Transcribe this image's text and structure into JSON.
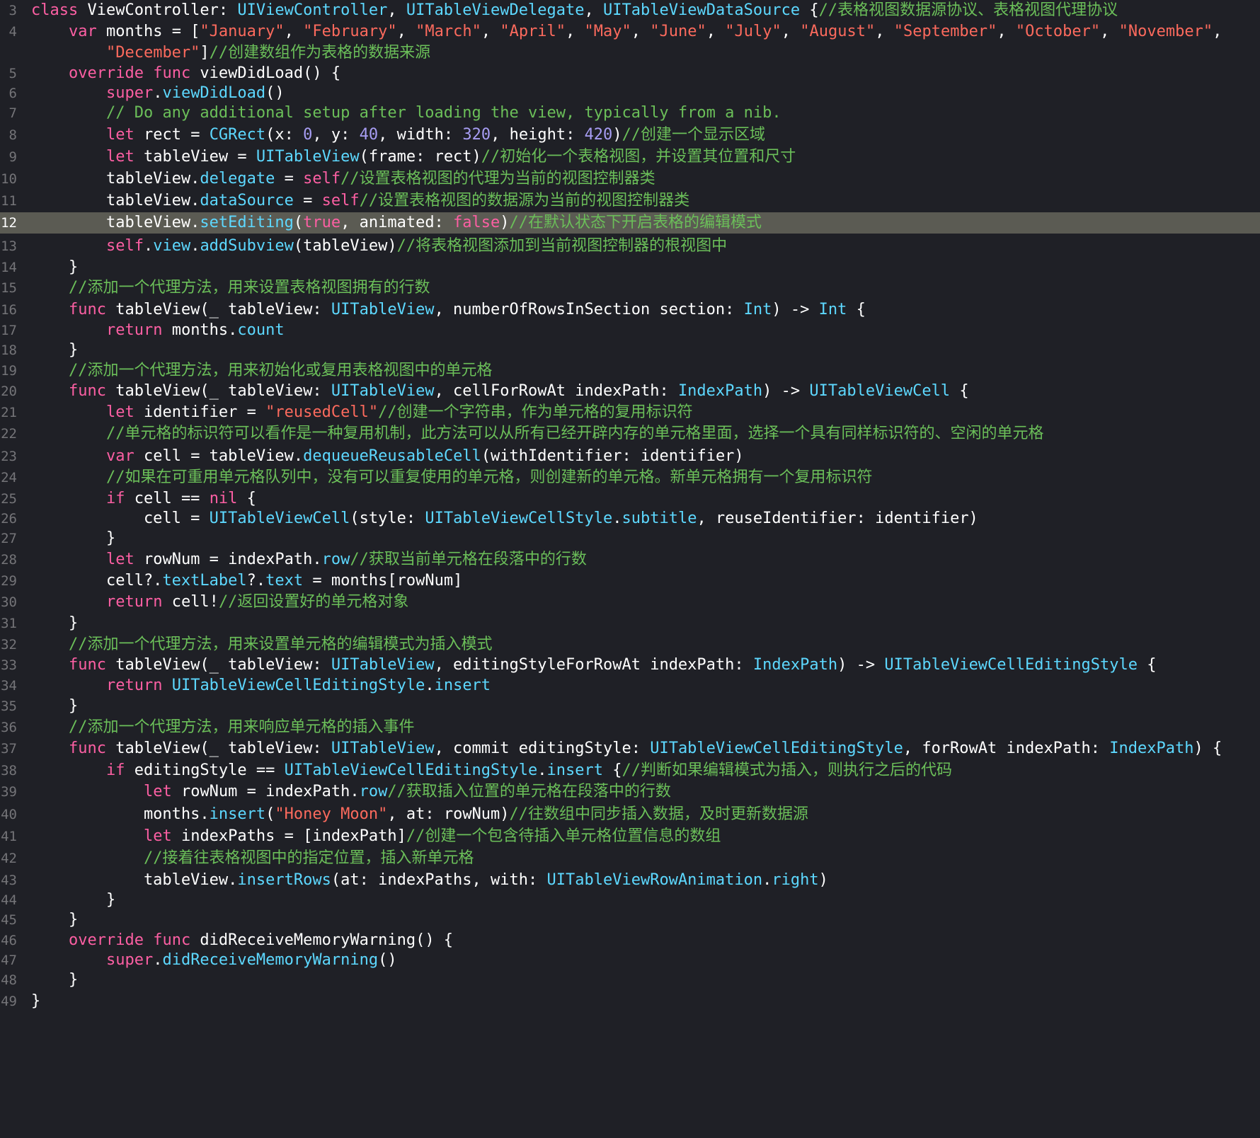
{
  "editor": {
    "language": "Swift",
    "theme": {
      "background": "#1f2026",
      "highlight_line": "#5b5b53",
      "gutter_text": "#747478",
      "keyword": "#fc5fa3",
      "type": "#5dd8ff",
      "string": "#fc6a5d",
      "comment": "#6bbf59",
      "number": "#a79df3",
      "plain": "#ffffff"
    },
    "highlighted_line": 12,
    "lines": [
      {
        "n": "3",
        "tokens": [
          [
            "kw",
            "class"
          ],
          [
            "pl",
            " ViewController: "
          ],
          [
            "ty",
            "UIViewController"
          ],
          [
            "pl",
            ", "
          ],
          [
            "ty",
            "UITableViewDelegate"
          ],
          [
            "pl",
            ", "
          ],
          [
            "ty",
            "UITableViewDataSource"
          ],
          [
            "pl",
            " {"
          ],
          [
            "cm",
            "//表格视图数据源协议、表格视图代理协议"
          ]
        ]
      },
      {
        "n": "4",
        "tokens": [
          [
            "pl",
            "    "
          ],
          [
            "kw",
            "var"
          ],
          [
            "pl",
            " months = ["
          ],
          [
            "st",
            "\"January\""
          ],
          [
            "pl",
            ", "
          ],
          [
            "st",
            "\"February\""
          ],
          [
            "pl",
            ", "
          ],
          [
            "st",
            "\"March\""
          ],
          [
            "pl",
            ", "
          ],
          [
            "st",
            "\"April\""
          ],
          [
            "pl",
            ", "
          ],
          [
            "st",
            "\"May\""
          ],
          [
            "pl",
            ", "
          ],
          [
            "st",
            "\"June\""
          ],
          [
            "pl",
            ", "
          ],
          [
            "st",
            "\"July\""
          ],
          [
            "pl",
            ", "
          ],
          [
            "st",
            "\"August\""
          ],
          [
            "pl",
            ", "
          ],
          [
            "st",
            "\"September\""
          ],
          [
            "pl",
            ", "
          ],
          [
            "st",
            "\"October\""
          ],
          [
            "pl",
            ", "
          ],
          [
            "st",
            "\"November\""
          ],
          [
            "pl",
            ","
          ]
        ]
      },
      {
        "n": "",
        "tokens": [
          [
            "pl",
            "        "
          ],
          [
            "st",
            "\"December\""
          ],
          [
            "pl",
            "]"
          ],
          [
            "cm",
            "//创建数组作为表格的数据来源"
          ]
        ]
      },
      {
        "n": "5",
        "tokens": [
          [
            "pl",
            "    "
          ],
          [
            "kw",
            "override"
          ],
          [
            "pl",
            " "
          ],
          [
            "kw",
            "func"
          ],
          [
            "pl",
            " viewDidLoad() {"
          ]
        ]
      },
      {
        "n": "6",
        "tokens": [
          [
            "pl",
            "        "
          ],
          [
            "kw",
            "super"
          ],
          [
            "pl",
            "."
          ],
          [
            "ty",
            "viewDidLoad"
          ],
          [
            "pl",
            "()"
          ]
        ]
      },
      {
        "n": "7",
        "tokens": [
          [
            "pl",
            "        "
          ],
          [
            "cm",
            "// Do any additional setup after loading the view, typically from a nib."
          ]
        ]
      },
      {
        "n": "8",
        "tokens": [
          [
            "pl",
            "        "
          ],
          [
            "kw",
            "let"
          ],
          [
            "pl",
            " rect = "
          ],
          [
            "ty",
            "CGRect"
          ],
          [
            "pl",
            "(x: "
          ],
          [
            "nu",
            "0"
          ],
          [
            "pl",
            ", y: "
          ],
          [
            "nu",
            "40"
          ],
          [
            "pl",
            ", width: "
          ],
          [
            "nu",
            "320"
          ],
          [
            "pl",
            ", height: "
          ],
          [
            "nu",
            "420"
          ],
          [
            "pl",
            ")"
          ],
          [
            "cm",
            "//创建一个显示区域"
          ]
        ]
      },
      {
        "n": "9",
        "tokens": [
          [
            "pl",
            "        "
          ],
          [
            "kw",
            "let"
          ],
          [
            "pl",
            " tableView = "
          ],
          [
            "ty",
            "UITableView"
          ],
          [
            "pl",
            "(frame: rect)"
          ],
          [
            "cm",
            "//初始化一个表格视图，并设置其位置和尺寸"
          ]
        ]
      },
      {
        "n": "10",
        "tokens": [
          [
            "pl",
            "        tableView."
          ],
          [
            "ty",
            "delegate"
          ],
          [
            "pl",
            " = "
          ],
          [
            "kw",
            "self"
          ],
          [
            "cm",
            "//设置表格视图的代理为当前的视图控制器类"
          ]
        ]
      },
      {
        "n": "11",
        "tokens": [
          [
            "pl",
            "        tableView."
          ],
          [
            "ty",
            "dataSource"
          ],
          [
            "pl",
            " = "
          ],
          [
            "kw",
            "self"
          ],
          [
            "cm",
            "//设置表格视图的数据源为当前的视图控制器类"
          ]
        ]
      },
      {
        "n": "12",
        "tokens": [
          [
            "pl",
            "        tableView."
          ],
          [
            "ty",
            "setEditing"
          ],
          [
            "pl",
            "("
          ],
          [
            "kw",
            "true"
          ],
          [
            "pl",
            ", animated: "
          ],
          [
            "kw",
            "false"
          ],
          [
            "pl",
            ")"
          ],
          [
            "cm",
            "//在默认状态下开启表格的编辑模式"
          ]
        ]
      },
      {
        "n": "13",
        "tokens": [
          [
            "pl",
            "        "
          ],
          [
            "kw",
            "self"
          ],
          [
            "pl",
            "."
          ],
          [
            "ty",
            "view"
          ],
          [
            "pl",
            "."
          ],
          [
            "ty",
            "addSubview"
          ],
          [
            "pl",
            "(tableView)"
          ],
          [
            "cm",
            "//将表格视图添加到当前视图控制器的根视图中"
          ]
        ]
      },
      {
        "n": "14",
        "tokens": [
          [
            "pl",
            "    }"
          ]
        ]
      },
      {
        "n": "15",
        "tokens": [
          [
            "pl",
            "    "
          ],
          [
            "cm",
            "//添加一个代理方法，用来设置表格视图拥有的行数"
          ]
        ]
      },
      {
        "n": "16",
        "tokens": [
          [
            "pl",
            "    "
          ],
          [
            "kw",
            "func"
          ],
          [
            "pl",
            " tableView(_ tableView: "
          ],
          [
            "ty",
            "UITableView"
          ],
          [
            "pl",
            ", numberOfRowsInSection section: "
          ],
          [
            "ty",
            "Int"
          ],
          [
            "pl",
            ") -> "
          ],
          [
            "ty",
            "Int"
          ],
          [
            "pl",
            " {"
          ]
        ]
      },
      {
        "n": "17",
        "tokens": [
          [
            "pl",
            "        "
          ],
          [
            "kw",
            "return"
          ],
          [
            "pl",
            " months."
          ],
          [
            "ty",
            "count"
          ]
        ]
      },
      {
        "n": "18",
        "tokens": [
          [
            "pl",
            "    }"
          ]
        ]
      },
      {
        "n": "19",
        "tokens": [
          [
            "pl",
            "    "
          ],
          [
            "cm",
            "//添加一个代理方法，用来初始化或复用表格视图中的单元格"
          ]
        ]
      },
      {
        "n": "20",
        "tokens": [
          [
            "pl",
            "    "
          ],
          [
            "kw",
            "func"
          ],
          [
            "pl",
            " tableView(_ tableView: "
          ],
          [
            "ty",
            "UITableView"
          ],
          [
            "pl",
            ", cellForRowAt indexPath: "
          ],
          [
            "ty",
            "IndexPath"
          ],
          [
            "pl",
            ") -> "
          ],
          [
            "ty",
            "UITableViewCell"
          ],
          [
            "pl",
            " {"
          ]
        ]
      },
      {
        "n": "21",
        "tokens": [
          [
            "pl",
            "        "
          ],
          [
            "kw",
            "let"
          ],
          [
            "pl",
            " identifier = "
          ],
          [
            "st",
            "\"reusedCell\""
          ],
          [
            "cm",
            "//创建一个字符串，作为单元格的复用标识符"
          ]
        ]
      },
      {
        "n": "22",
        "tokens": [
          [
            "pl",
            "        "
          ],
          [
            "cm",
            "//单元格的标识符可以看作是一种复用机制，此方法可以从所有已经开辟内存的单元格里面，选择一个具有同样标识符的、空闲的单元格"
          ]
        ]
      },
      {
        "n": "23",
        "tokens": [
          [
            "pl",
            "        "
          ],
          [
            "kw",
            "var"
          ],
          [
            "pl",
            " cell = tableView."
          ],
          [
            "ty",
            "dequeueReusableCell"
          ],
          [
            "pl",
            "(withIdentifier: identifier)"
          ]
        ]
      },
      {
        "n": "24",
        "tokens": [
          [
            "pl",
            "        "
          ],
          [
            "cm",
            "//如果在可重用单元格队列中，没有可以重复使用的单元格，则创建新的单元格。新单元格拥有一个复用标识符"
          ]
        ]
      },
      {
        "n": "25",
        "tokens": [
          [
            "pl",
            "        "
          ],
          [
            "kw",
            "if"
          ],
          [
            "pl",
            " cell == "
          ],
          [
            "kw",
            "nil"
          ],
          [
            "pl",
            " {"
          ]
        ]
      },
      {
        "n": "26",
        "tokens": [
          [
            "pl",
            "            cell = "
          ],
          [
            "ty",
            "UITableViewCell"
          ],
          [
            "pl",
            "(style: "
          ],
          [
            "ty",
            "UITableViewCellStyle"
          ],
          [
            "pl",
            "."
          ],
          [
            "ty",
            "subtitle"
          ],
          [
            "pl",
            ", reuseIdentifier: identifier)"
          ]
        ]
      },
      {
        "n": "27",
        "tokens": [
          [
            "pl",
            "        }"
          ]
        ]
      },
      {
        "n": "28",
        "tokens": [
          [
            "pl",
            "        "
          ],
          [
            "kw",
            "let"
          ],
          [
            "pl",
            " rowNum = indexPath."
          ],
          [
            "ty",
            "row"
          ],
          [
            "cm",
            "//获取当前单元格在段落中的行数"
          ]
        ]
      },
      {
        "n": "29",
        "tokens": [
          [
            "pl",
            "        cell?."
          ],
          [
            "ty",
            "textLabel"
          ],
          [
            "pl",
            "?."
          ],
          [
            "ty",
            "text"
          ],
          [
            "pl",
            " = months[rowNum]"
          ]
        ]
      },
      {
        "n": "30",
        "tokens": [
          [
            "pl",
            "        "
          ],
          [
            "kw",
            "return"
          ],
          [
            "pl",
            " cell!"
          ],
          [
            "cm",
            "//返回设置好的单元格对象"
          ]
        ]
      },
      {
        "n": "31",
        "tokens": [
          [
            "pl",
            "    }"
          ]
        ]
      },
      {
        "n": "32",
        "tokens": [
          [
            "pl",
            "    "
          ],
          [
            "cm",
            "//添加一个代理方法，用来设置单元格的编辑模式为插入模式"
          ]
        ]
      },
      {
        "n": "33",
        "tokens": [
          [
            "pl",
            "    "
          ],
          [
            "kw",
            "func"
          ],
          [
            "pl",
            " tableView(_ tableView: "
          ],
          [
            "ty",
            "UITableView"
          ],
          [
            "pl",
            ", editingStyleForRowAt indexPath: "
          ],
          [
            "ty",
            "IndexPath"
          ],
          [
            "pl",
            ") -> "
          ],
          [
            "ty",
            "UITableViewCellEditingStyle"
          ],
          [
            "pl",
            " {"
          ]
        ]
      },
      {
        "n": "34",
        "tokens": [
          [
            "pl",
            "        "
          ],
          [
            "kw",
            "return"
          ],
          [
            "pl",
            " "
          ],
          [
            "ty",
            "UITableViewCellEditingStyle"
          ],
          [
            "pl",
            "."
          ],
          [
            "ty",
            "insert"
          ]
        ]
      },
      {
        "n": "35",
        "tokens": [
          [
            "pl",
            "    }"
          ]
        ]
      },
      {
        "n": "36",
        "tokens": [
          [
            "pl",
            "    "
          ],
          [
            "cm",
            "//添加一个代理方法，用来响应单元格的插入事件"
          ]
        ]
      },
      {
        "n": "37",
        "tokens": [
          [
            "pl",
            "    "
          ],
          [
            "kw",
            "func"
          ],
          [
            "pl",
            " tableView(_ tableView: "
          ],
          [
            "ty",
            "UITableView"
          ],
          [
            "pl",
            ", commit editingStyle: "
          ],
          [
            "ty",
            "UITableViewCellEditingStyle"
          ],
          [
            "pl",
            ", forRowAt indexPath: "
          ],
          [
            "ty",
            "IndexPath"
          ],
          [
            "pl",
            ") {"
          ]
        ]
      },
      {
        "n": "38",
        "tokens": [
          [
            "pl",
            "        "
          ],
          [
            "kw",
            "if"
          ],
          [
            "pl",
            " editingStyle == "
          ],
          [
            "ty",
            "UITableViewCellEditingStyle"
          ],
          [
            "pl",
            "."
          ],
          [
            "ty",
            "insert"
          ],
          [
            "pl",
            " {"
          ],
          [
            "cm",
            "//判断如果编辑模式为插入，则执行之后的代码"
          ]
        ]
      },
      {
        "n": "39",
        "tokens": [
          [
            "pl",
            "            "
          ],
          [
            "kw",
            "let"
          ],
          [
            "pl",
            " rowNum = indexPath."
          ],
          [
            "ty",
            "row"
          ],
          [
            "cm",
            "//获取插入位置的单元格在段落中的行数"
          ]
        ]
      },
      {
        "n": "40",
        "tokens": [
          [
            "pl",
            "            months."
          ],
          [
            "ty",
            "insert"
          ],
          [
            "pl",
            "("
          ],
          [
            "st",
            "\"Honey Moon\""
          ],
          [
            "pl",
            ", at: rowNum)"
          ],
          [
            "cm",
            "//往数组中同步插入数据，及时更新数据源"
          ]
        ]
      },
      {
        "n": "41",
        "tokens": [
          [
            "pl",
            "            "
          ],
          [
            "kw",
            "let"
          ],
          [
            "pl",
            " indexPaths = [indexPath]"
          ],
          [
            "cm",
            "//创建一个包含待插入单元格位置信息的数组"
          ]
        ]
      },
      {
        "n": "42",
        "tokens": [
          [
            "pl",
            "            "
          ],
          [
            "cm",
            "//接着往表格视图中的指定位置，插入新单元格"
          ]
        ]
      },
      {
        "n": "43",
        "tokens": [
          [
            "pl",
            "            tableView."
          ],
          [
            "ty",
            "insertRows"
          ],
          [
            "pl",
            "(at: indexPaths, with: "
          ],
          [
            "ty",
            "UITableViewRowAnimation"
          ],
          [
            "pl",
            "."
          ],
          [
            "ty",
            "right"
          ],
          [
            "pl",
            ")"
          ]
        ]
      },
      {
        "n": "44",
        "tokens": [
          [
            "pl",
            "        }"
          ]
        ]
      },
      {
        "n": "45",
        "tokens": [
          [
            "pl",
            "    }"
          ]
        ]
      },
      {
        "n": "46",
        "tokens": [
          [
            "pl",
            "    "
          ],
          [
            "kw",
            "override"
          ],
          [
            "pl",
            " "
          ],
          [
            "kw",
            "func"
          ],
          [
            "pl",
            " didReceiveMemoryWarning() {"
          ]
        ]
      },
      {
        "n": "47",
        "tokens": [
          [
            "pl",
            "        "
          ],
          [
            "kw",
            "super"
          ],
          [
            "pl",
            "."
          ],
          [
            "ty",
            "didReceiveMemoryWarning"
          ],
          [
            "pl",
            "()"
          ]
        ]
      },
      {
        "n": "48",
        "tokens": [
          [
            "pl",
            "    }"
          ]
        ]
      },
      {
        "n": "49",
        "tokens": [
          [
            "pl",
            "}"
          ]
        ]
      }
    ]
  }
}
